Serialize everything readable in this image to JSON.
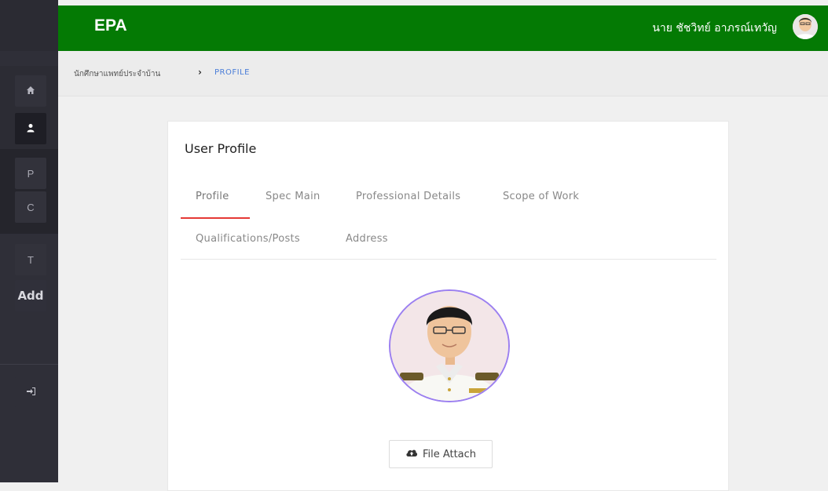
{
  "header": {
    "brand": "EPA",
    "user_name": "นาย ชัชวิทย์ อาภรณ์เทวัญ"
  },
  "sidebar": {
    "items": [
      {
        "icon": "home-icon",
        "label": ""
      },
      {
        "icon": "user-icon",
        "label": ""
      },
      {
        "icon": "",
        "label": "P"
      },
      {
        "icon": "",
        "label": "C"
      },
      {
        "icon": "",
        "label": "T"
      },
      {
        "icon": "",
        "label": "Add"
      },
      {
        "icon": "sign-in-icon",
        "label": ""
      }
    ]
  },
  "breadcrumb": {
    "home": "นักศึกษาแพทย์ประจำบ้าน",
    "separator": "›",
    "current": "PROFILE"
  },
  "card": {
    "title": "User Profile",
    "tabs": [
      {
        "label": "Profile",
        "active": true
      },
      {
        "label": "Spec Main",
        "active": false
      },
      {
        "label": "Professional Details",
        "active": false
      },
      {
        "label": "Scope of Work",
        "active": false
      },
      {
        "label": "Qualifications/Posts",
        "active": false
      },
      {
        "label": "Address",
        "active": false
      }
    ],
    "file_attach_label": "File Attach"
  },
  "colors": {
    "header_green": "#047a04",
    "active_tab_underline": "#e53935",
    "photo_ring": "#9b7ff0",
    "breadcrumb_link": "#4a7dd8"
  }
}
